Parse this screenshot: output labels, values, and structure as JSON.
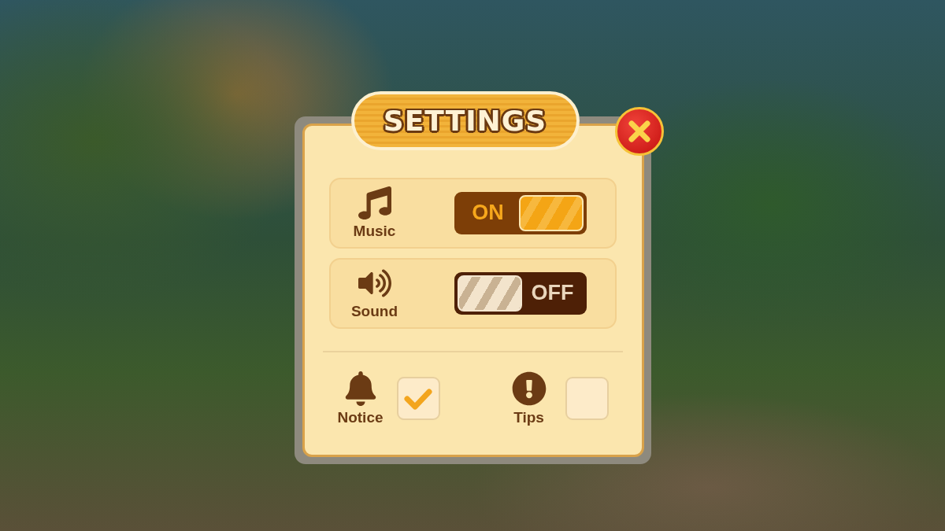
{
  "title": "SETTINGS",
  "toggles": [
    {
      "kind": "music",
      "label": "Music",
      "on": true,
      "state_text": "ON"
    },
    {
      "kind": "sound",
      "label": "Sound",
      "on": false,
      "state_text": "OFF"
    }
  ],
  "options": [
    {
      "kind": "notice",
      "label": "Notice",
      "checked": true
    },
    {
      "kind": "tips",
      "label": "Tips",
      "checked": false
    }
  ]
}
